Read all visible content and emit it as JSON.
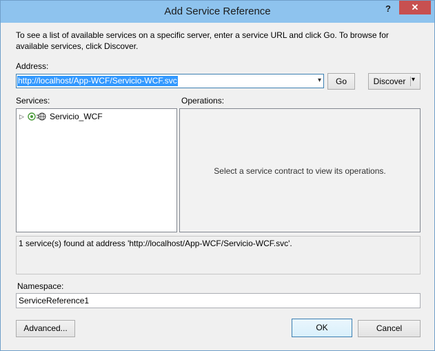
{
  "window": {
    "title": "Add Service Reference",
    "help_glyph": "?",
    "close_glyph": "✕"
  },
  "instructions": "To see a list of available services on a specific server, enter a service URL and click Go. To browse for available services, click Discover.",
  "address": {
    "label": "Address:",
    "value": "http://localhost/App-WCF/Servicio-WCF.svc",
    "dropdown_glyph": "▾"
  },
  "buttons": {
    "go": "Go",
    "discover": "Discover",
    "discover_arrow": "▾",
    "advanced": "Advanced...",
    "ok": "OK",
    "cancel": "Cancel"
  },
  "services": {
    "label": "Services:",
    "items": [
      {
        "label": "Servicio_WCF",
        "expanded": false,
        "expander_glyph": "▷",
        "icon": "service-globe-icon"
      }
    ]
  },
  "operations": {
    "label": "Operations:",
    "placeholder": "Select a service contract to view its operations."
  },
  "status": "1 service(s) found at address 'http://localhost/App-WCF/Servicio-WCF.svc'.",
  "namespace": {
    "label": "Namespace:",
    "value": "ServiceReference1"
  },
  "colors": {
    "titlebar": "#8ec3ee",
    "close_button": "#c75050",
    "selection": "#3399ff",
    "focus_border": "#3c7fb1"
  }
}
